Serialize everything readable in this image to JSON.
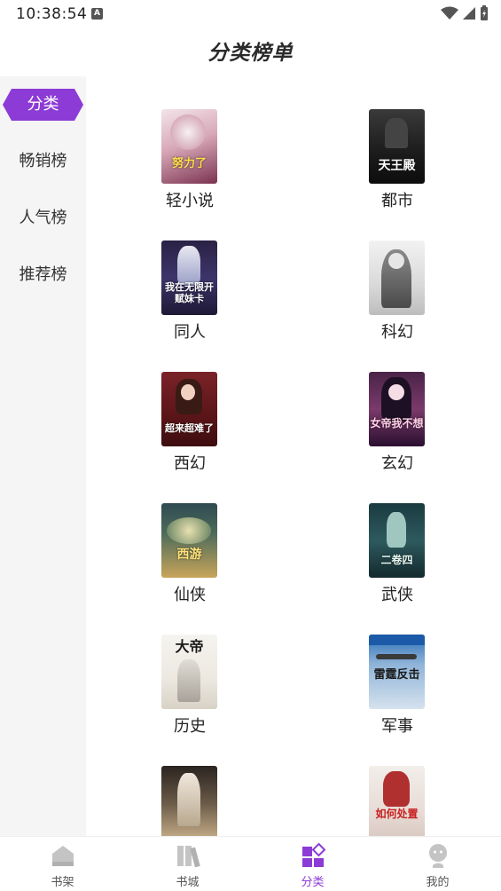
{
  "status_bar": {
    "time": "10:38:54"
  },
  "header": {
    "title": "分类榜单"
  },
  "sidebar": {
    "items": [
      {
        "label": "分类",
        "active": true
      },
      {
        "label": "畅销榜"
      },
      {
        "label": "人气榜"
      },
      {
        "label": "推荐榜"
      }
    ]
  },
  "categories": [
    {
      "label": "轻小说",
      "cover_text": "努力了"
    },
    {
      "label": "都市",
      "cover_text": "天王殿"
    },
    {
      "label": "同人",
      "cover_text": "我在无限开赋妹卡"
    },
    {
      "label": "科幻"
    },
    {
      "label": "西幻",
      "cover_text": "超来超难了"
    },
    {
      "label": "玄幻",
      "cover_text": "女帝我不想"
    },
    {
      "label": "仙侠",
      "cover_text": "西游"
    },
    {
      "label": "武侠",
      "cover_text": "二卷四"
    },
    {
      "label": "历史",
      "cover_text": "大帝"
    },
    {
      "label": "军事",
      "cover_text": "雷霆反击"
    },
    {
      "label": ""
    },
    {
      "label": "",
      "cover_text": "如何处置"
    }
  ],
  "bottom_nav": {
    "items": [
      {
        "label": "书架",
        "icon": "bookshelf-icon"
      },
      {
        "label": "书城",
        "icon": "bookstore-icon"
      },
      {
        "label": "分类",
        "icon": "category-icon",
        "active": true
      },
      {
        "label": "我的",
        "icon": "profile-icon"
      }
    ]
  },
  "colors": {
    "accent": "#8c3bd6",
    "sidebar_bg": "#f5f5f5"
  }
}
